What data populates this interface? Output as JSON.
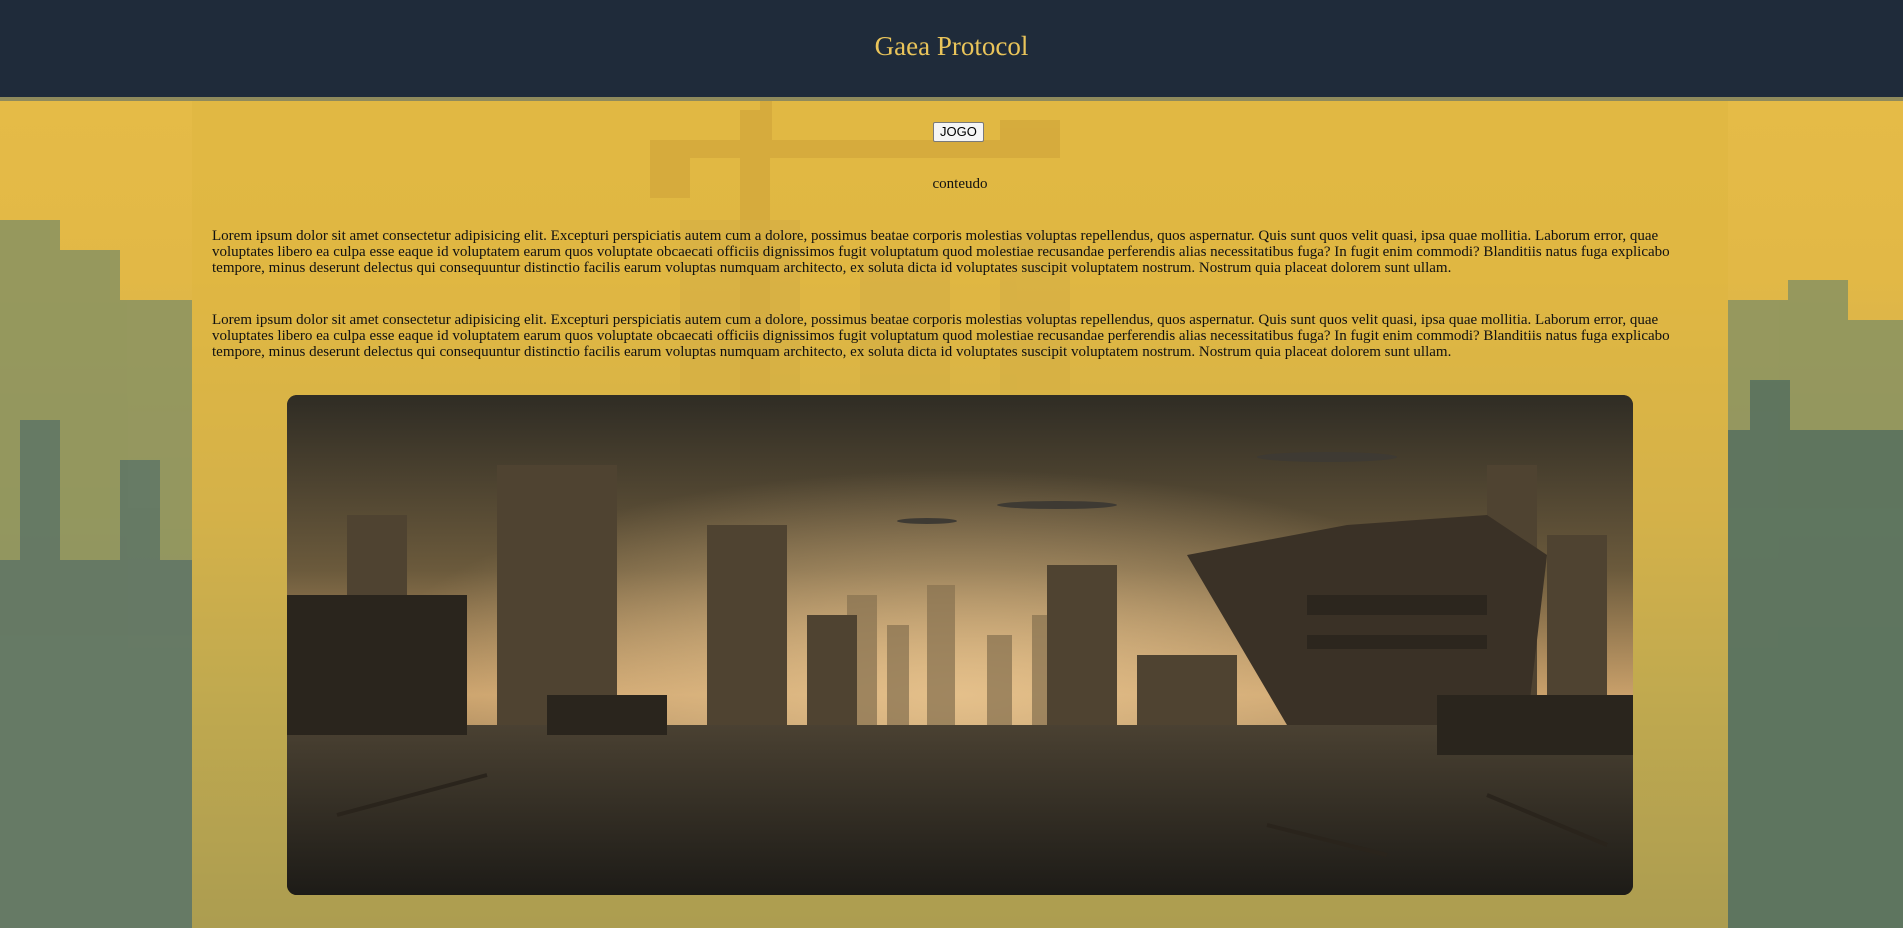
{
  "header": {
    "title": "Gaea Protocol"
  },
  "main": {
    "game_button_label": "JOGO",
    "content_label": "conteudo",
    "paragraphs": [
      "Lorem ipsum dolor sit amet consectetur adipisicing elit. Excepturi perspiciatis autem cum a dolore, possimus beatae corporis molestias voluptas repellendus, quos aspernatur. Quis sunt quos velit quasi, ipsa quae mollitia. Laborum error, quae voluptates libero ea culpa esse eaque id voluptatem earum quos voluptate obcaecati officiis dignissimos fugit voluptatum quod molestiae recusandae perferendis alias necessitatibus fuga? In fugit enim commodi? Blanditiis natus fuga explicabo tempore, minus deserunt delectus qui consequuntur distinctio facilis earum voluptas numquam architecto, ex soluta dicta id voluptates suscipit voluptatem nostrum. Nostrum quia placeat dolorem sunt ullam.",
      "Lorem ipsum dolor sit amet consectetur adipisicing elit. Excepturi perspiciatis autem cum a dolore, possimus beatae corporis molestias voluptas repellendus, quos aspernatur. Quis sunt quos velit quasi, ipsa quae mollitia. Laborum error, quae voluptates libero ea culpa esse eaque id voluptatem earum quos voluptate obcaecati officiis dignissimos fugit voluptatum quod molestiae recusandae perferendis alias necessitatibus fuga? In fugit enim commodi? Blanditiis natus fuga explicabo tempore, minus deserunt delectus qui consequuntur distinctio facilis earum voluptas numquam architecto, ex soluta dicta id voluptates suscipit voluptatem nostrum. Nostrum quia placeat dolorem sunt ullam."
    ]
  },
  "colors": {
    "header_bg": "#1f2b3a",
    "title_gold": "#e9c45a",
    "page_gold": "#e2b846"
  }
}
